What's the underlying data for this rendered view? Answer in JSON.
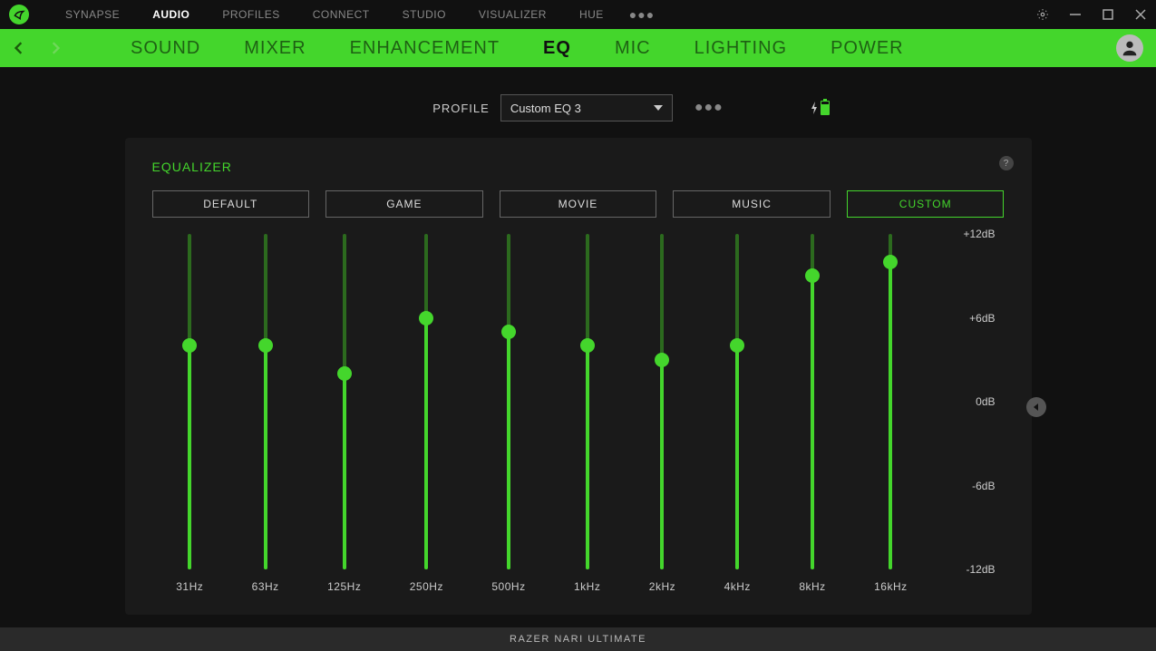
{
  "top_tabs": [
    "SYNAPSE",
    "AUDIO",
    "PROFILES",
    "CONNECT",
    "STUDIO",
    "VISUALIZER",
    "HUE"
  ],
  "top_active": 1,
  "sub_tabs": [
    "SOUND",
    "MIXER",
    "ENHANCEMENT",
    "EQ",
    "MIC",
    "LIGHTING",
    "POWER"
  ],
  "sub_active": 3,
  "profile": {
    "label": "PROFILE",
    "value": "Custom EQ 3"
  },
  "panel": {
    "title": "EQUALIZER",
    "presets": [
      "DEFAULT",
      "GAME",
      "MOVIE",
      "MUSIC",
      "CUSTOM"
    ],
    "preset_active": 4,
    "scale": [
      "+12dB",
      "+6dB",
      "0dB",
      "-6dB",
      "-12dB"
    ],
    "bands": [
      {
        "freq": "31Hz",
        "db": 4.0
      },
      {
        "freq": "63Hz",
        "db": 4.0
      },
      {
        "freq": "125Hz",
        "db": 2.0
      },
      {
        "freq": "250Hz",
        "db": 6.0
      },
      {
        "freq": "500Hz",
        "db": 5.0
      },
      {
        "freq": "1kHz",
        "db": 4.0
      },
      {
        "freq": "2kHz",
        "db": 3.0
      },
      {
        "freq": "4kHz",
        "db": 4.0
      },
      {
        "freq": "8kHz",
        "db": 9.0
      },
      {
        "freq": "16kHz",
        "db": 10.0
      }
    ]
  },
  "footer": "RAZER NARI ULTIMATE",
  "chart_data": {
    "type": "bar",
    "title": "EQUALIZER",
    "ylabel": "dB",
    "ylim": [
      -12,
      12
    ],
    "categories": [
      "31Hz",
      "63Hz",
      "125Hz",
      "250Hz",
      "500Hz",
      "1kHz",
      "2kHz",
      "4kHz",
      "8kHz",
      "16kHz"
    ],
    "values": [
      4.0,
      4.0,
      2.0,
      6.0,
      5.0,
      4.0,
      3.0,
      4.0,
      9.0,
      10.0
    ]
  }
}
